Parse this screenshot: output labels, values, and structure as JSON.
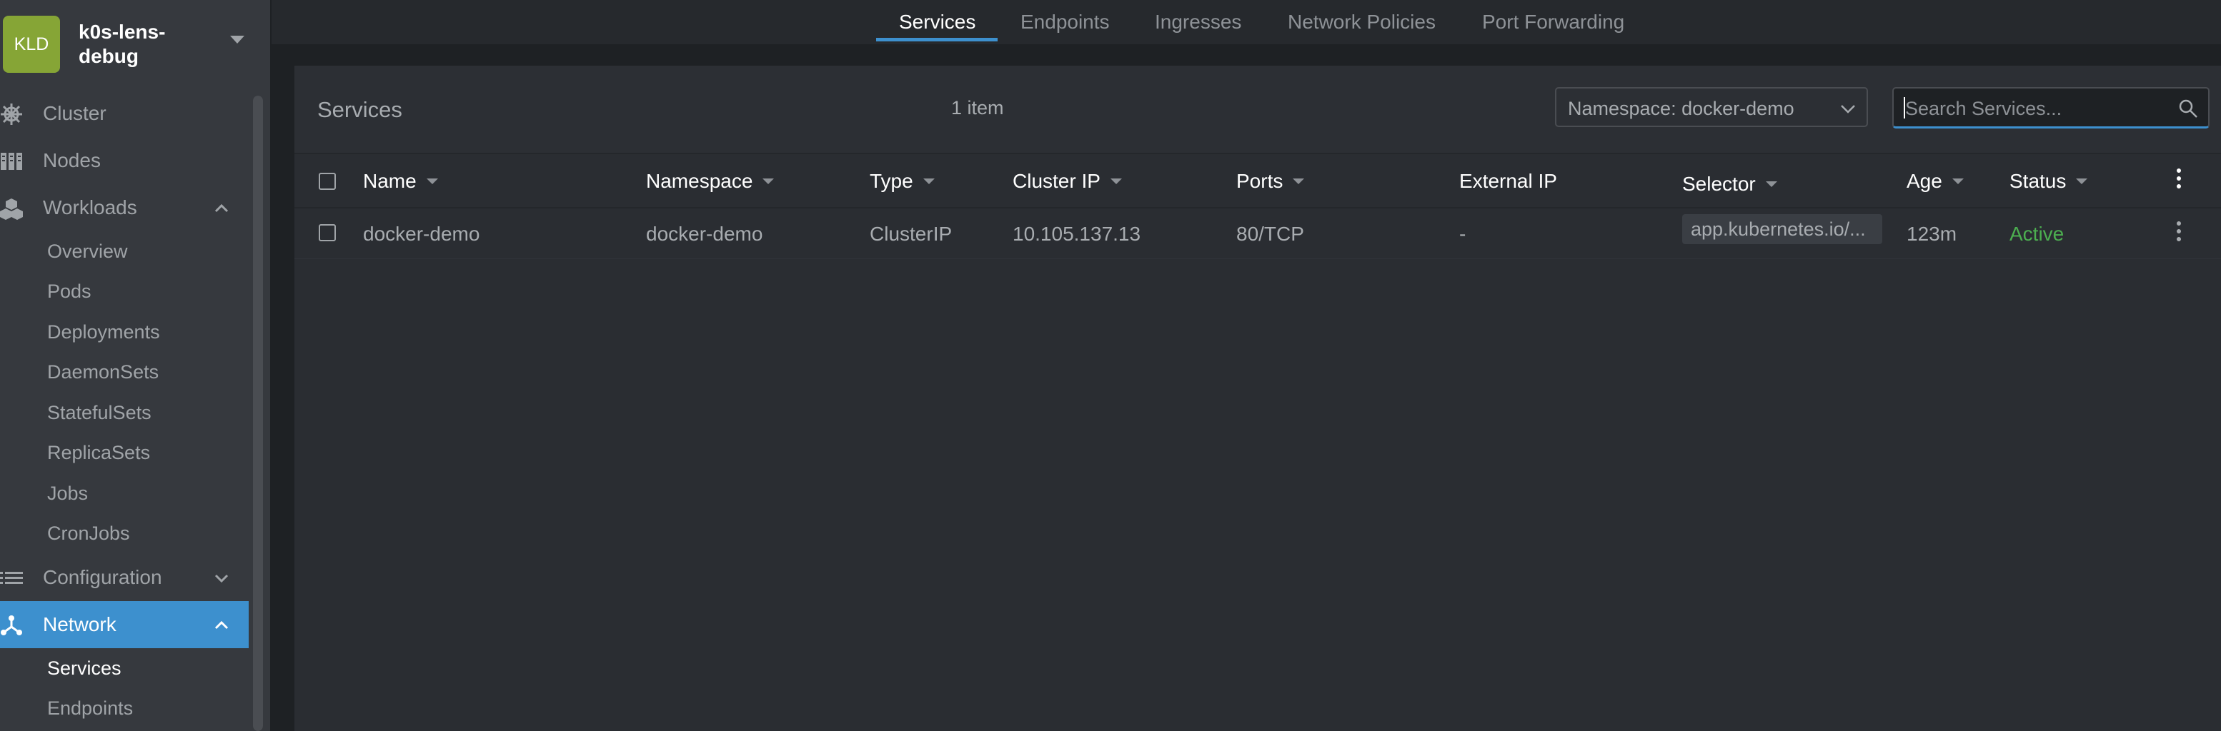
{
  "cluster": {
    "badge": "KLD",
    "name": "k0s-lens-debug"
  },
  "sidebar": {
    "items": [
      {
        "label": "Cluster",
        "icon": "helm-wheel-icon"
      },
      {
        "label": "Nodes",
        "icon": "server-rack-icon"
      },
      {
        "label": "Workloads",
        "icon": "cubes-icon",
        "expanded": true,
        "children": [
          "Overview",
          "Pods",
          "Deployments",
          "DaemonSets",
          "StatefulSets",
          "ReplicaSets",
          "Jobs",
          "CronJobs"
        ]
      },
      {
        "label": "Configuration",
        "icon": "list-icon",
        "expanded": false
      },
      {
        "label": "Network",
        "icon": "network-icon",
        "expanded": true,
        "active": true,
        "children": [
          "Services",
          "Endpoints"
        ]
      }
    ]
  },
  "tabs": [
    "Services",
    "Endpoints",
    "Ingresses",
    "Network Policies",
    "Port Forwarding"
  ],
  "active_tab": "Services",
  "page": {
    "title": "Services",
    "count": "1 item",
    "namespace_select": "Namespace: docker-demo",
    "search_placeholder": "Search Services..."
  },
  "table": {
    "columns": [
      "Name",
      "Namespace",
      "Type",
      "Cluster IP",
      "Ports",
      "External IP",
      "Selector",
      "Age",
      "Status"
    ],
    "rows": [
      {
        "name": "docker-demo",
        "namespace": "docker-demo",
        "type": "ClusterIP",
        "cluster_ip": "10.105.137.13",
        "ports": "80/TCP",
        "external_ip": "-",
        "selector": "app.kubernetes.io/...",
        "age": "123m",
        "status": "Active"
      }
    ]
  },
  "colors": {
    "accent": "#3d90ce",
    "cluster_badge": "#86a536",
    "status_active": "#4caf50"
  }
}
